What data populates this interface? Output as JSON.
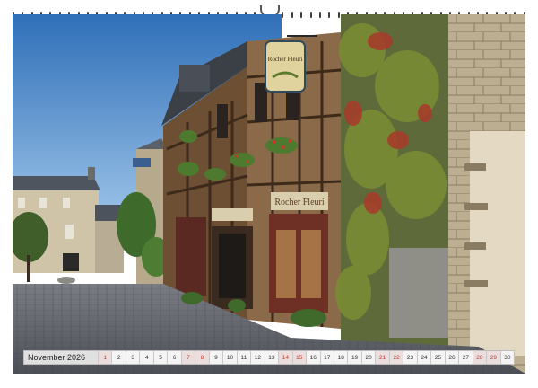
{
  "calendar": {
    "month_label": "November 2026",
    "days": [
      {
        "n": "1",
        "weekend": true
      },
      {
        "n": "2",
        "weekend": false
      },
      {
        "n": "3",
        "weekend": false
      },
      {
        "n": "4",
        "weekend": false
      },
      {
        "n": "5",
        "weekend": false
      },
      {
        "n": "6",
        "weekend": false
      },
      {
        "n": "7",
        "weekend": true
      },
      {
        "n": "8",
        "weekend": true
      },
      {
        "n": "9",
        "weekend": false
      },
      {
        "n": "10",
        "weekend": false
      },
      {
        "n": "11",
        "weekend": false
      },
      {
        "n": "12",
        "weekend": false
      },
      {
        "n": "13",
        "weekend": false
      },
      {
        "n": "14",
        "weekend": true
      },
      {
        "n": "15",
        "weekend": true
      },
      {
        "n": "16",
        "weekend": false
      },
      {
        "n": "17",
        "weekend": false
      },
      {
        "n": "18",
        "weekend": false
      },
      {
        "n": "19",
        "weekend": false
      },
      {
        "n": "20",
        "weekend": false
      },
      {
        "n": "21",
        "weekend": true
      },
      {
        "n": "22",
        "weekend": true
      },
      {
        "n": "23",
        "weekend": false
      },
      {
        "n": "24",
        "weekend": false
      },
      {
        "n": "25",
        "weekend": false
      },
      {
        "n": "26",
        "weekend": false
      },
      {
        "n": "27",
        "weekend": false
      },
      {
        "n": "28",
        "weekend": true
      },
      {
        "n": "29",
        "weekend": true
      },
      {
        "n": "30",
        "weekend": false
      }
    ]
  },
  "scene": {
    "hanging_sign_text": "Rocher Fleuri",
    "shop_sign_text": "Rocher Fleuri",
    "colors": {
      "sky": "#3d7fc8",
      "cobblestone": "#5a5f6a",
      "timber": "#7a5a3c",
      "ivy": "#5b7a2e",
      "ivy_red": "#a33a2a",
      "stone": "#b9a98c"
    }
  }
}
